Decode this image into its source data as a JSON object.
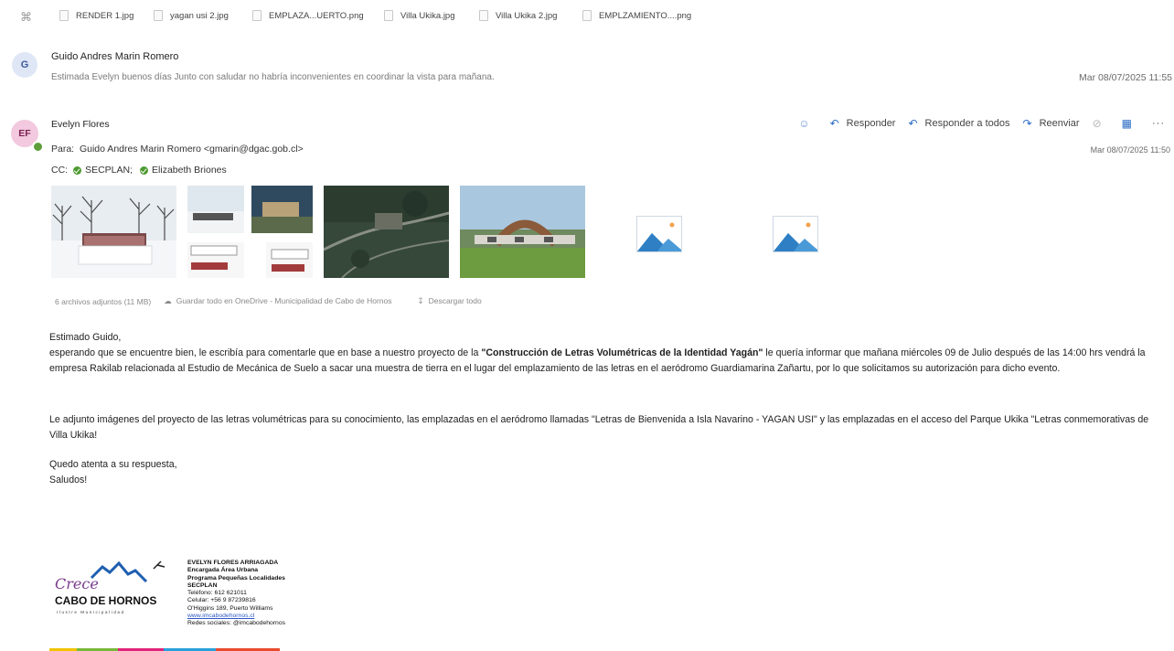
{
  "attachment_strip": {
    "files": [
      "RENDER 1.jpg",
      "yagan usi 2.jpg",
      "EMPLAZA...UERTO.png",
      "Villa Ukika.jpg",
      "Villa Ukika 2.jpg",
      "EMPLZAMIENTO....png"
    ]
  },
  "message1": {
    "avatar_initial": "G",
    "sender": "Guido Andres Marin Romero",
    "preview": "Estimada Evelyn buenos días Junto con saludar no habría inconvenientes en coordinar la vista para mañana.",
    "date": "Mar 08/07/2025 11:55"
  },
  "message2": {
    "avatar_initials": "EF",
    "sender": "Evelyn Flores",
    "to_label": "Para:",
    "to_value": "Guido Andres Marin Romero <gmarin@dgac.gob.cl>",
    "cc_label": "CC:",
    "cc": [
      "SECPLAN;",
      "Elizabeth Briones"
    ],
    "date": "Mar 08/07/2025 11:50",
    "toolbar": {
      "reply": "Responder",
      "reply_all": "Responder a todos",
      "forward": "Reenviar"
    },
    "attachments_meta": {
      "count": "6 archivos adjuntos (11 MB)",
      "save_onedrive": "Guardar todo en OneDrive - Municipalidad de Cabo de Hornos",
      "download_all": "Descargar todo"
    },
    "body": {
      "greeting": "Estimado Guido,",
      "p1_pre": "esperando que se encuentre bien, le escribía para  comentarle que en base a nuestro proyecto de la ",
      "p1_bold": "\"Construcción  de Letras Volumétricas de la Identidad Yagán\"",
      "p1_post": " le quería informar que mañana miércoles 09 de Julio después de las 14:00 hrs vendrá la empresa Rakilab  relacionada al Estudio de Mecánica de Suelo a sacar una muestra de tierra en el lugar del emplazamiento de las letras en el aeródromo Guardiamarina Zañartu, por lo que solicitamos su autorización para dicho evento.",
      "p2": "Le adjunto imágenes del proyecto de las letras volumétricas para su conocimiento, las emplazadas en el aeródromo llamadas \"Letras de Bienvenida a Isla Navarino - YAGAN USI\" y las emplazadas en el acceso del Parque Ukika \"Letras conmemorativas de Villa Ukika!",
      "closing1": "Quedo atenta a su respuesta,",
      "closing2": "Saludos!"
    },
    "signature": {
      "logo_script": "Crece",
      "logo_name": "CABO DE HORNOS",
      "logo_sub": "Ilustre Municipalidad",
      "name": "EVELYN FLORES ARRIAGADA",
      "role1": "Encargada Área Urbana",
      "role2": "Programa Pequeñas Localidades",
      "dept": "SECPLAN",
      "phone": "Teléfono: 612 621011",
      "cell": "Celular: +56 9 87239816",
      "address": "O'Higgins 189, Puerto Williams",
      "web": "www.imcabodehornos.cl",
      "social": "Redes sociales: @imcabodehornos"
    }
  },
  "colors": {
    "accent": "#2b6cc4",
    "presence": "#5c9f3a",
    "signature_bar": [
      "#f2c400",
      "#78b83a",
      "#e0247a",
      "#2aa0dc",
      "#e84b2f"
    ]
  }
}
